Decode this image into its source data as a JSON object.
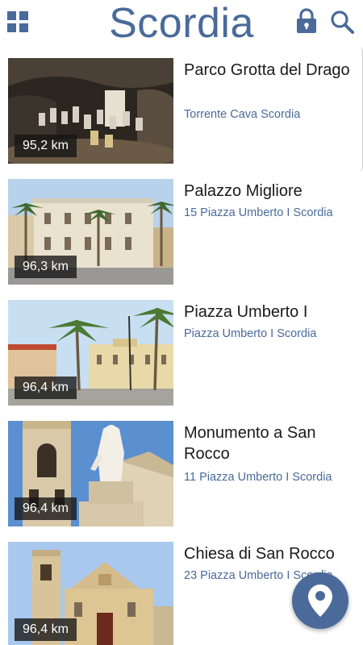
{
  "app": {
    "title": "Scordia",
    "menu_icon": "grid-menu-icon",
    "lock_icon": "lock-icon",
    "search_icon": "search-icon",
    "accent_color": "#4a6a9a"
  },
  "places": [
    {
      "name": "Parco Grotta del Drago",
      "address": "Torrente Cava Scordia",
      "distance": "95,2 km"
    },
    {
      "name": "Palazzo Migliore",
      "address": "15 Piazza Umberto I Scordia",
      "distance": "96,3 km"
    },
    {
      "name": "Piazza Umberto I",
      "address": "Piazza Umberto I Scordia",
      "distance": "96,4 km"
    },
    {
      "name": "Monumento a San Rocco",
      "address": "11 Piazza Umberto I Scordia",
      "distance": "96,4 km"
    },
    {
      "name": "Chiesa di San Rocco",
      "address": "23 Piazza Umberto I Scordia",
      "distance": "96,4 km"
    }
  ],
  "fab": {
    "icon": "map-pin-icon"
  }
}
